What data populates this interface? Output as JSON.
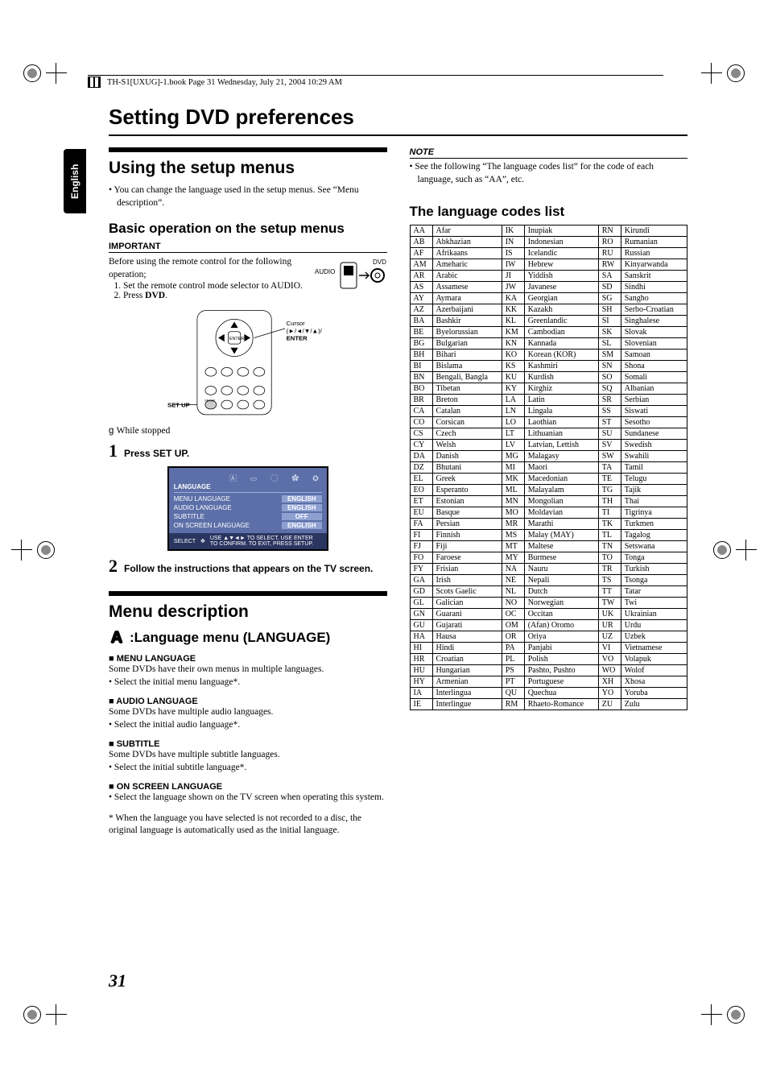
{
  "header_line": "TH-S1[UXUG]-1.book  Page 31  Wednesday, July 21, 2004  10:29 AM",
  "side_tab": "English",
  "main_title": "Setting DVD preferences",
  "page_number": "31",
  "left": {
    "section1_title": "Using the setup menus",
    "section1_intro_bullet": "You can change the language used in the setup menus. See “Menu description”.",
    "sub_basic": "Basic operation on the setup menus",
    "important_label": "IMPORTANT",
    "important_intro": "Before using the remote control for the following operation;",
    "important_steps": [
      "Set the remote control mode selector to AUDIO.",
      "Press DVD."
    ],
    "mode_labels": {
      "audio": "AUDIO",
      "dvd": "DVD"
    },
    "remote_labels": {
      "setup": "SET UP",
      "cursor": "Cursor",
      "cursor_sym": "(►/◄/▼/▲)/",
      "enter": "ENTER"
    },
    "while_stopped": "While stopped",
    "step1_num": "1",
    "step1_txt": "Press SET UP.",
    "setup_screen": {
      "title": "LANGUAGE",
      "rows": [
        {
          "k": "MENU LANGUAGE",
          "v": "ENGLISH"
        },
        {
          "k": "AUDIO LANGUAGE",
          "v": "ENGLISH"
        },
        {
          "k": "SUBTITLE",
          "v": "OFF"
        },
        {
          "k": "ON SCREEN LANGUAGE",
          "v": "ENGLISH"
        }
      ],
      "foot_select": "SELECT",
      "foot_hint": "USE ▲▼◄► TO SELECT, USE ENTER TO CONFIRM. TO EXIT, PRESS SETUP.",
      "foot_enter": "ENTER"
    },
    "step2_num": "2",
    "step2_txt": "Follow the instructions that appears on the TV screen.",
    "section2_title": "Menu description",
    "menu_head": ":Language menu (LANGUAGE)",
    "menu_lang_h": "MENU LANGUAGE",
    "menu_lang_p": "Some DVDs have their own menus in multiple languages.",
    "menu_lang_b": "Select the initial menu language*.",
    "audio_lang_h": "AUDIO LANGUAGE",
    "audio_lang_p": "Some DVDs have multiple audio languages.",
    "audio_lang_b": "Select the initial audio language*.",
    "subtitle_h": "SUBTITLE",
    "subtitle_p": "Some DVDs have multiple subtitle languages.",
    "subtitle_b": "Select the initial subtitle language*.",
    "osd_h": "ON SCREEN LANGUAGE",
    "osd_b": "Select the language shown on the TV screen when operating this system.",
    "footnote": "* When the language you have selected is not recorded to a disc, the original language is automatically used as the initial language."
  },
  "right": {
    "note_label": "NOTE",
    "note_bullet": "See the following “The language codes list” for the code of each language, such as “AA”, etc.",
    "codes_heading": "The language codes list",
    "codes": [
      [
        "AA",
        "Afar",
        "IK",
        "Inupiak",
        "RN",
        "Kirundi"
      ],
      [
        "AB",
        "Abkhazian",
        "IN",
        "Indonesian",
        "RO",
        "Rumanian"
      ],
      [
        "AF",
        "Afrikaans",
        "IS",
        "Icelandic",
        "RU",
        "Russian"
      ],
      [
        "AM",
        "Ameharic",
        "IW",
        "Hebrew",
        "RW",
        "Kinyarwanda"
      ],
      [
        "AR",
        "Arabic",
        "JI",
        "Yiddish",
        "SA",
        "Sanskrit"
      ],
      [
        "AS",
        "Assamese",
        "JW",
        "Javanese",
        "SD",
        "Sindhi"
      ],
      [
        "AY",
        "Aymara",
        "KA",
        "Georgian",
        "SG",
        "Sangho"
      ],
      [
        "AZ",
        "Azerbaijani",
        "KK",
        "Kazakh",
        "SH",
        "Serbo-Croatian"
      ],
      [
        "BA",
        "Bashkir",
        "KL",
        "Greenlandic",
        "SI",
        "Singhalese"
      ],
      [
        "BE",
        "Byelorussian",
        "KM",
        "Cambodian",
        "SK",
        "Slovak"
      ],
      [
        "BG",
        "Bulgarian",
        "KN",
        "Kannada",
        "SL",
        "Slovenian"
      ],
      [
        "BH",
        "Bihari",
        "KO",
        "Korean (KOR)",
        "SM",
        "Samoan"
      ],
      [
        "BI",
        "Bislama",
        "KS",
        "Kashmiri",
        "SN",
        "Shona"
      ],
      [
        "BN",
        "Bengali, Bangla",
        "KU",
        "Kurdish",
        "SO",
        "Somali"
      ],
      [
        "BO",
        "Tibetan",
        "KY",
        "Kirghiz",
        "SQ",
        "Albanian"
      ],
      [
        "BR",
        "Breton",
        "LA",
        "Latin",
        "SR",
        "Serbian"
      ],
      [
        "CA",
        "Catalan",
        "LN",
        "Lingala",
        "SS",
        "Siswati"
      ],
      [
        "CO",
        "Corsican",
        "LO",
        "Laothian",
        "ST",
        "Sesotho"
      ],
      [
        "CS",
        "Czech",
        "LT",
        "Lithuanian",
        "SU",
        "Sundanese"
      ],
      [
        "CY",
        "Welsh",
        "LV",
        "Latvian, Lettish",
        "SV",
        "Swedish"
      ],
      [
        "DA",
        "Danish",
        "MG",
        "Malagasy",
        "SW",
        "Swahili"
      ],
      [
        "DZ",
        "Bhutani",
        "MI",
        "Maori",
        "TA",
        "Tamil"
      ],
      [
        "EL",
        "Greek",
        "MK",
        "Macedonian",
        "TE",
        "Telugu"
      ],
      [
        "EO",
        "Esperanto",
        "ML",
        "Malayalam",
        "TG",
        "Tajik"
      ],
      [
        "ET",
        "Estonian",
        "MN",
        "Mongolian",
        "TH",
        "Thai"
      ],
      [
        "EU",
        "Basque",
        "MO",
        "Moldavian",
        "TI",
        "Tigrinya"
      ],
      [
        "FA",
        "Persian",
        "MR",
        "Marathi",
        "TK",
        "Turkmen"
      ],
      [
        "FI",
        "Finnish",
        "MS",
        "Malay (MAY)",
        "TL",
        "Tagalog"
      ],
      [
        "FJ",
        "Fiji",
        "MT",
        "Maltese",
        "TN",
        "Setswana"
      ],
      [
        "FO",
        "Faroese",
        "MY",
        "Burmese",
        "TO",
        "Tonga"
      ],
      [
        "FY",
        "Frisian",
        "NA",
        "Nauru",
        "TR",
        "Turkish"
      ],
      [
        "GA",
        "Irish",
        "NE",
        "Nepali",
        "TS",
        "Tsonga"
      ],
      [
        "GD",
        "Scots Gaelic",
        "NL",
        "Dutch",
        "TT",
        "Tatar"
      ],
      [
        "GL",
        "Galician",
        "NO",
        "Norwegian",
        "TW",
        "Twi"
      ],
      [
        "GN",
        "Guarani",
        "OC",
        "Occitan",
        "UK",
        "Ukrainian"
      ],
      [
        "GU",
        "Gujarati",
        "OM",
        "(Afan) Oromo",
        "UR",
        "Urdu"
      ],
      [
        "HA",
        "Hausa",
        "OR",
        "Oriya",
        "UZ",
        "Uzbek"
      ],
      [
        "HI",
        "Hindi",
        "PA",
        "Panjabi",
        "VI",
        "Vietnamese"
      ],
      [
        "HR",
        "Croatian",
        "PL",
        "Polish",
        "VO",
        "Volapuk"
      ],
      [
        "HU",
        "Hungarian",
        "PS",
        "Pashto, Pushto",
        "WO",
        "Wolof"
      ],
      [
        "HY",
        "Armenian",
        "PT",
        "Portuguese",
        "XH",
        "Xhosa"
      ],
      [
        "IA",
        "Interlingua",
        "QU",
        "Quechua",
        "YO",
        "Yoruba"
      ],
      [
        "IE",
        "Interlingue",
        "RM",
        "Rhaeto-Romance",
        "ZU",
        "Zulu"
      ]
    ]
  }
}
